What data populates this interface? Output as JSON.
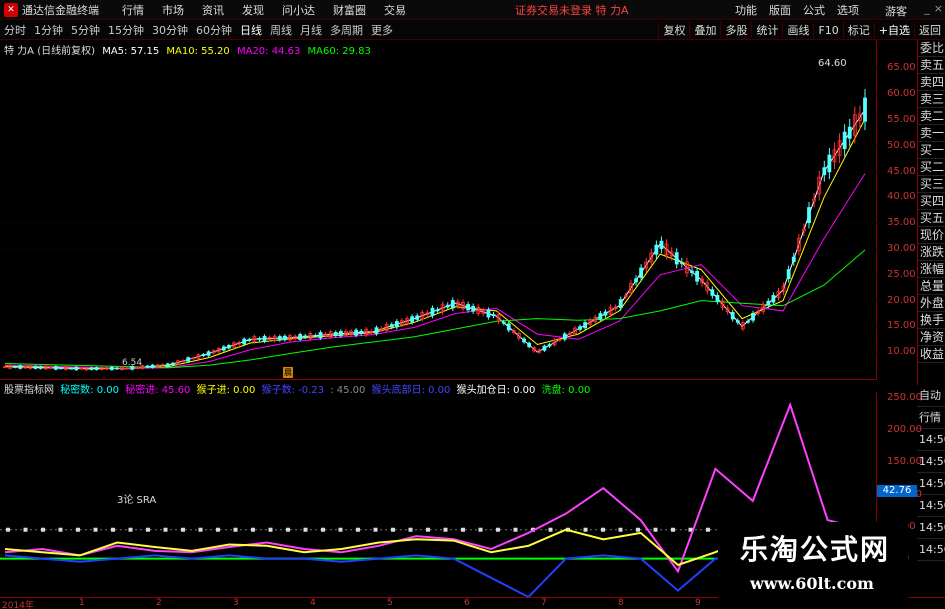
{
  "topbar": {
    "app_title": "通达信金融终端",
    "menu": [
      "行情",
      "市场",
      "资讯",
      "发现",
      "问小达",
      "财富圈",
      "交易"
    ],
    "warning": "证券交易未登录 特 力A",
    "right_menu": [
      "功能",
      "版面",
      "公式",
      "选项"
    ],
    "guest": "游客"
  },
  "periodbar": {
    "periods": [
      "分时",
      "1分钟",
      "5分钟",
      "15分钟",
      "30分钟",
      "60分钟",
      "日线",
      "周线",
      "月线",
      "多周期",
      "更多"
    ],
    "active": "日线",
    "tools": [
      "复权",
      "叠加",
      "多股",
      "统计",
      "画线",
      "F10",
      "标记",
      "+自选",
      "返回"
    ]
  },
  "main_legend": {
    "stock": "特 力A (日线前复权)",
    "ma5": "MA5: 57.15",
    "ma10": "MA10: 55.20",
    "ma20": "MA20: 44.63",
    "ma60": "MA60: 29.83",
    "colors": {
      "ma5": "#ffffff",
      "ma10": "#ffff00",
      "ma20": "#ff00ff",
      "ma60": "#00ff00"
    }
  },
  "sub_legend": {
    "name": "股票指标网",
    "items": [
      {
        "label": "秘密数: 0.00",
        "color": "#00ffff"
      },
      {
        "label": "秘密进: 45.60",
        "color": "#ff00ff"
      },
      {
        "label": "猴子进: 0.00",
        "color": "#ffff00"
      },
      {
        "label": "猴子数: -0.23",
        "color": "#4040ff"
      },
      {
        "label": ": 45.00",
        "color": "#888888"
      },
      {
        "label": "猴头底部日: 0.00",
        "color": "#4040ff"
      },
      {
        "label": "猴头加仓日: 0.00",
        "color": "#ffffff"
      },
      {
        "label": "洗盘: 0.00",
        "color": "#00ff00"
      }
    ]
  },
  "annotations": {
    "peak": "64.60",
    "low": "6.54",
    "marker": "晨",
    "sra": "3论 SRA",
    "current": "42.76"
  },
  "sidebar_top": [
    "委比",
    "卖五",
    "卖四",
    "卖三",
    "卖二",
    "卖一",
    "买一",
    "买二",
    "买三",
    "买四",
    "买五",
    "现价",
    "涨跌",
    "涨幅",
    "总量",
    "外盘",
    "换手",
    "净资",
    "收益"
  ],
  "sidebar_bottom": [
    "自动",
    "行情",
    "14:50",
    "14:50",
    "14:50",
    "14:50",
    "14:50",
    "14:50"
  ],
  "watermark": {
    "title": "乐淘公式网",
    "url": "www.60lt.com"
  },
  "chart_data": [
    {
      "type": "candlestick",
      "title": "特 力A (日线前复权)",
      "yticks": [
        65.0,
        60.0,
        55.0,
        50.0,
        45.0,
        40.0,
        35.0,
        30.0,
        25.0,
        20.0,
        15.0,
        10.0
      ],
      "ylim": [
        5,
        67
      ],
      "x_labels": [
        "2014年",
        "1",
        "2",
        "3",
        "4",
        "5",
        "6",
        "7",
        "8",
        "9"
      ],
      "series": [
        {
          "name": "MA5",
          "values": [
            7.2,
            7.0,
            6.8,
            6.9,
            7.5,
            9.8,
            12.5,
            12.8,
            13.5,
            14.0,
            16.5,
            19.5,
            17.0,
            10.0,
            14.5,
            19.0,
            31.0,
            24.0,
            15.0,
            22.0,
            45.0,
            57.0
          ]
        },
        {
          "name": "MA10",
          "values": [
            7.3,
            7.1,
            6.9,
            6.8,
            7.2,
            9.0,
            11.8,
            12.6,
            13.2,
            13.8,
            15.8,
            18.8,
            18.0,
            11.5,
            13.5,
            18.0,
            29.0,
            26.0,
            16.5,
            20.0,
            40.0,
            55.2
          ]
        },
        {
          "name": "MA20",
          "values": [
            7.5,
            7.3,
            7.1,
            6.9,
            7.0,
            8.2,
            10.5,
            12.0,
            12.8,
            13.4,
            14.8,
            17.5,
            18.5,
            13.5,
            12.5,
            16.0,
            25.0,
            27.0,
            19.0,
            18.0,
            32.0,
            44.6
          ]
        },
        {
          "name": "MA60",
          "values": [
            7.8,
            7.6,
            7.4,
            7.2,
            7.0,
            7.5,
            8.5,
            9.8,
            11.0,
            12.0,
            13.0,
            14.5,
            16.0,
            16.5,
            16.2,
            16.5,
            18.0,
            20.0,
            19.5,
            19.0,
            23.0,
            29.8
          ]
        }
      ]
    },
    {
      "type": "line",
      "title": "股票指标网",
      "yticks": [
        250.0,
        200.0,
        150.0,
        100.0,
        50.0,
        0.0
      ],
      "ylim": [
        -60,
        260
      ],
      "series": [
        {
          "name": "秘密进",
          "values": [
            10,
            15,
            5,
            20,
            12,
            10,
            18,
            25,
            15,
            10,
            20,
            35,
            30,
            15,
            40,
            70,
            110,
            60,
            -20,
            140,
            90,
            240,
            60,
            45
          ]
        },
        {
          "name": "猴子进",
          "values": [
            15,
            10,
            5,
            25,
            18,
            12,
            22,
            20,
            10,
            15,
            25,
            30,
            28,
            10,
            20,
            45,
            30,
            40,
            -10,
            10,
            35,
            35,
            30,
            0
          ]
        },
        {
          "name": "洗盘",
          "values": [
            5,
            0,
            -5,
            0,
            5,
            0,
            5,
            0,
            0,
            -5,
            0,
            5,
            0,
            -30,
            -60,
            0,
            5,
            0,
            -50,
            0,
            5,
            0,
            0,
            0
          ]
        }
      ]
    }
  ]
}
